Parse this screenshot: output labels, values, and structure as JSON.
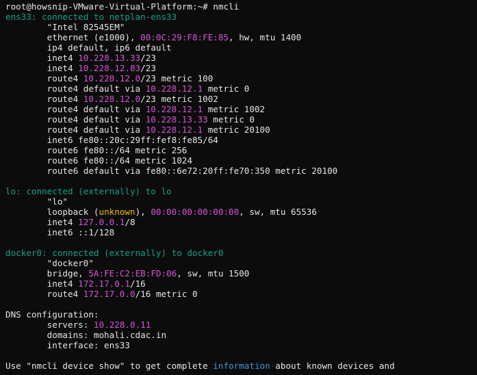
{
  "colors": {
    "background": "#0c0c0c",
    "text": "#e6e6e6",
    "device_header": "#16a085",
    "highlight_value": "#d655d6",
    "unknown_value": "#e5c100",
    "link_word": "#3a96dd"
  },
  "lines": [
    [
      {
        "t": "root@howsnip-VMware-Virtual-Platform:~# nmcli",
        "c": "plain"
      }
    ],
    [
      {
        "t": "ens33: connected to netplan-ens33",
        "c": "green"
      }
    ],
    [
      {
        "t": "        \"Intel 82545EM\"",
        "c": "plain"
      }
    ],
    [
      {
        "t": "        ethernet (e1000), ",
        "c": "plain"
      },
      {
        "t": "00:0C:29:F8:FE:85",
        "c": "magenta"
      },
      {
        "t": ", hw, mtu 1400",
        "c": "plain"
      }
    ],
    [
      {
        "t": "        ip4 default, ip6 default",
        "c": "plain"
      }
    ],
    [
      {
        "t": "        inet4 ",
        "c": "plain"
      },
      {
        "t": "10.228.13.33",
        "c": "magenta"
      },
      {
        "t": "/23",
        "c": "plain"
      }
    ],
    [
      {
        "t": "        inet4 ",
        "c": "plain"
      },
      {
        "t": "10.228.12.83",
        "c": "magenta"
      },
      {
        "t": "/23",
        "c": "plain"
      }
    ],
    [
      {
        "t": "        route4 ",
        "c": "plain"
      },
      {
        "t": "10.228.12.0",
        "c": "magenta"
      },
      {
        "t": "/23 metric 100",
        "c": "plain"
      }
    ],
    [
      {
        "t": "        route4 default via ",
        "c": "plain"
      },
      {
        "t": "10.228.12.1",
        "c": "magenta"
      },
      {
        "t": " metric 0",
        "c": "plain"
      }
    ],
    [
      {
        "t": "        route4 ",
        "c": "plain"
      },
      {
        "t": "10.228.12.0",
        "c": "magenta"
      },
      {
        "t": "/23 metric 1002",
        "c": "plain"
      }
    ],
    [
      {
        "t": "        route4 default via ",
        "c": "plain"
      },
      {
        "t": "10.228.12.1",
        "c": "magenta"
      },
      {
        "t": " metric 1002",
        "c": "plain"
      }
    ],
    [
      {
        "t": "        route4 default via ",
        "c": "plain"
      },
      {
        "t": "10.228.13.33",
        "c": "magenta"
      },
      {
        "t": " metric 0",
        "c": "plain"
      }
    ],
    [
      {
        "t": "        route4 default via ",
        "c": "plain"
      },
      {
        "t": "10.228.12.1",
        "c": "magenta"
      },
      {
        "t": " metric 20100",
        "c": "plain"
      }
    ],
    [
      {
        "t": "        inet6 fe80::20c:29ff:fef8:fe85/64",
        "c": "plain"
      }
    ],
    [
      {
        "t": "        route6 fe80::/64 metric 256",
        "c": "plain"
      }
    ],
    [
      {
        "t": "        route6 fe80::/64 metric 1024",
        "c": "plain"
      }
    ],
    [
      {
        "t": "        route6 default via fe80::6e72:20ff:fe70:350 metric 20100",
        "c": "plain"
      }
    ],
    [],
    [
      {
        "t": "lo: connected (externally) to lo",
        "c": "green"
      }
    ],
    [
      {
        "t": "        \"lo\"",
        "c": "plain"
      }
    ],
    [
      {
        "t": "        loopback (",
        "c": "plain"
      },
      {
        "t": "unknown",
        "c": "yellow"
      },
      {
        "t": "), ",
        "c": "plain"
      },
      {
        "t": "00:00:00:00:00:00",
        "c": "magenta"
      },
      {
        "t": ", sw, mtu 65536",
        "c": "plain"
      }
    ],
    [
      {
        "t": "        inet4 ",
        "c": "plain"
      },
      {
        "t": "127.0.0.1",
        "c": "magenta"
      },
      {
        "t": "/8",
        "c": "plain"
      }
    ],
    [
      {
        "t": "        inet6 ::1/128",
        "c": "plain"
      }
    ],
    [],
    [
      {
        "t": "docker0: connected (externally) to docker0",
        "c": "green"
      }
    ],
    [
      {
        "t": "        \"docker0\"",
        "c": "plain"
      }
    ],
    [
      {
        "t": "        bridge, ",
        "c": "plain"
      },
      {
        "t": "5A:FE:C2:EB:FD:06",
        "c": "magenta"
      },
      {
        "t": ", sw, mtu 1500",
        "c": "plain"
      }
    ],
    [
      {
        "t": "        inet4 ",
        "c": "plain"
      },
      {
        "t": "172.17.0.1",
        "c": "magenta"
      },
      {
        "t": "/16",
        "c": "plain"
      }
    ],
    [
      {
        "t": "        route4 ",
        "c": "plain"
      },
      {
        "t": "172.17.0.0",
        "c": "magenta"
      },
      {
        "t": "/16 metric 0",
        "c": "plain"
      }
    ],
    [],
    [
      {
        "t": "DNS configuration:",
        "c": "plain"
      }
    ],
    [
      {
        "t": "        servers: ",
        "c": "plain"
      },
      {
        "t": "10.228.0.11",
        "c": "magenta"
      }
    ],
    [
      {
        "t": "        domains: mohali.cdac.in",
        "c": "plain"
      }
    ],
    [
      {
        "t": "        interface: ens33",
        "c": "plain"
      }
    ],
    [],
    [
      {
        "t": "Use \"nmcli device show\" to get complete ",
        "c": "plain"
      },
      {
        "t": "information",
        "c": "blue"
      },
      {
        "t": " about known devices and",
        "c": "plain"
      }
    ]
  ]
}
